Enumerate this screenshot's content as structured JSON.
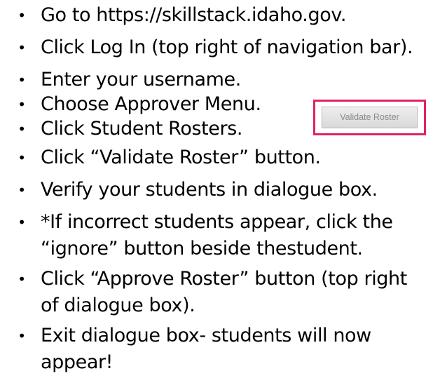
{
  "steps": [
    {
      "text": "Go to https://skillstack.idaho.gov."
    },
    {
      "text": "Click Log In (top right of navigation bar)."
    },
    {
      "text": "Enter your username."
    },
    {
      "text": "Choose Approver Menu."
    },
    {
      "text": "Click Student Rosters."
    },
    {
      "text": "Click “Validate Roster” button."
    },
    {
      "text": "Verify your students in dialogue box."
    },
    {
      "text": "*If incorrect students appear, click the",
      "cont": "“ignore” button beside thestudent."
    },
    {
      "text": "Click “Approve Roster” button (top right",
      "cont": "of dialogue box)."
    },
    {
      "text": "Exit dialogue box- students will now",
      "cont": "appear!"
    }
  ],
  "bullet_glyph": "•",
  "callout": {
    "button_label": "Validate Roster",
    "border_color": "#e0245e"
  }
}
